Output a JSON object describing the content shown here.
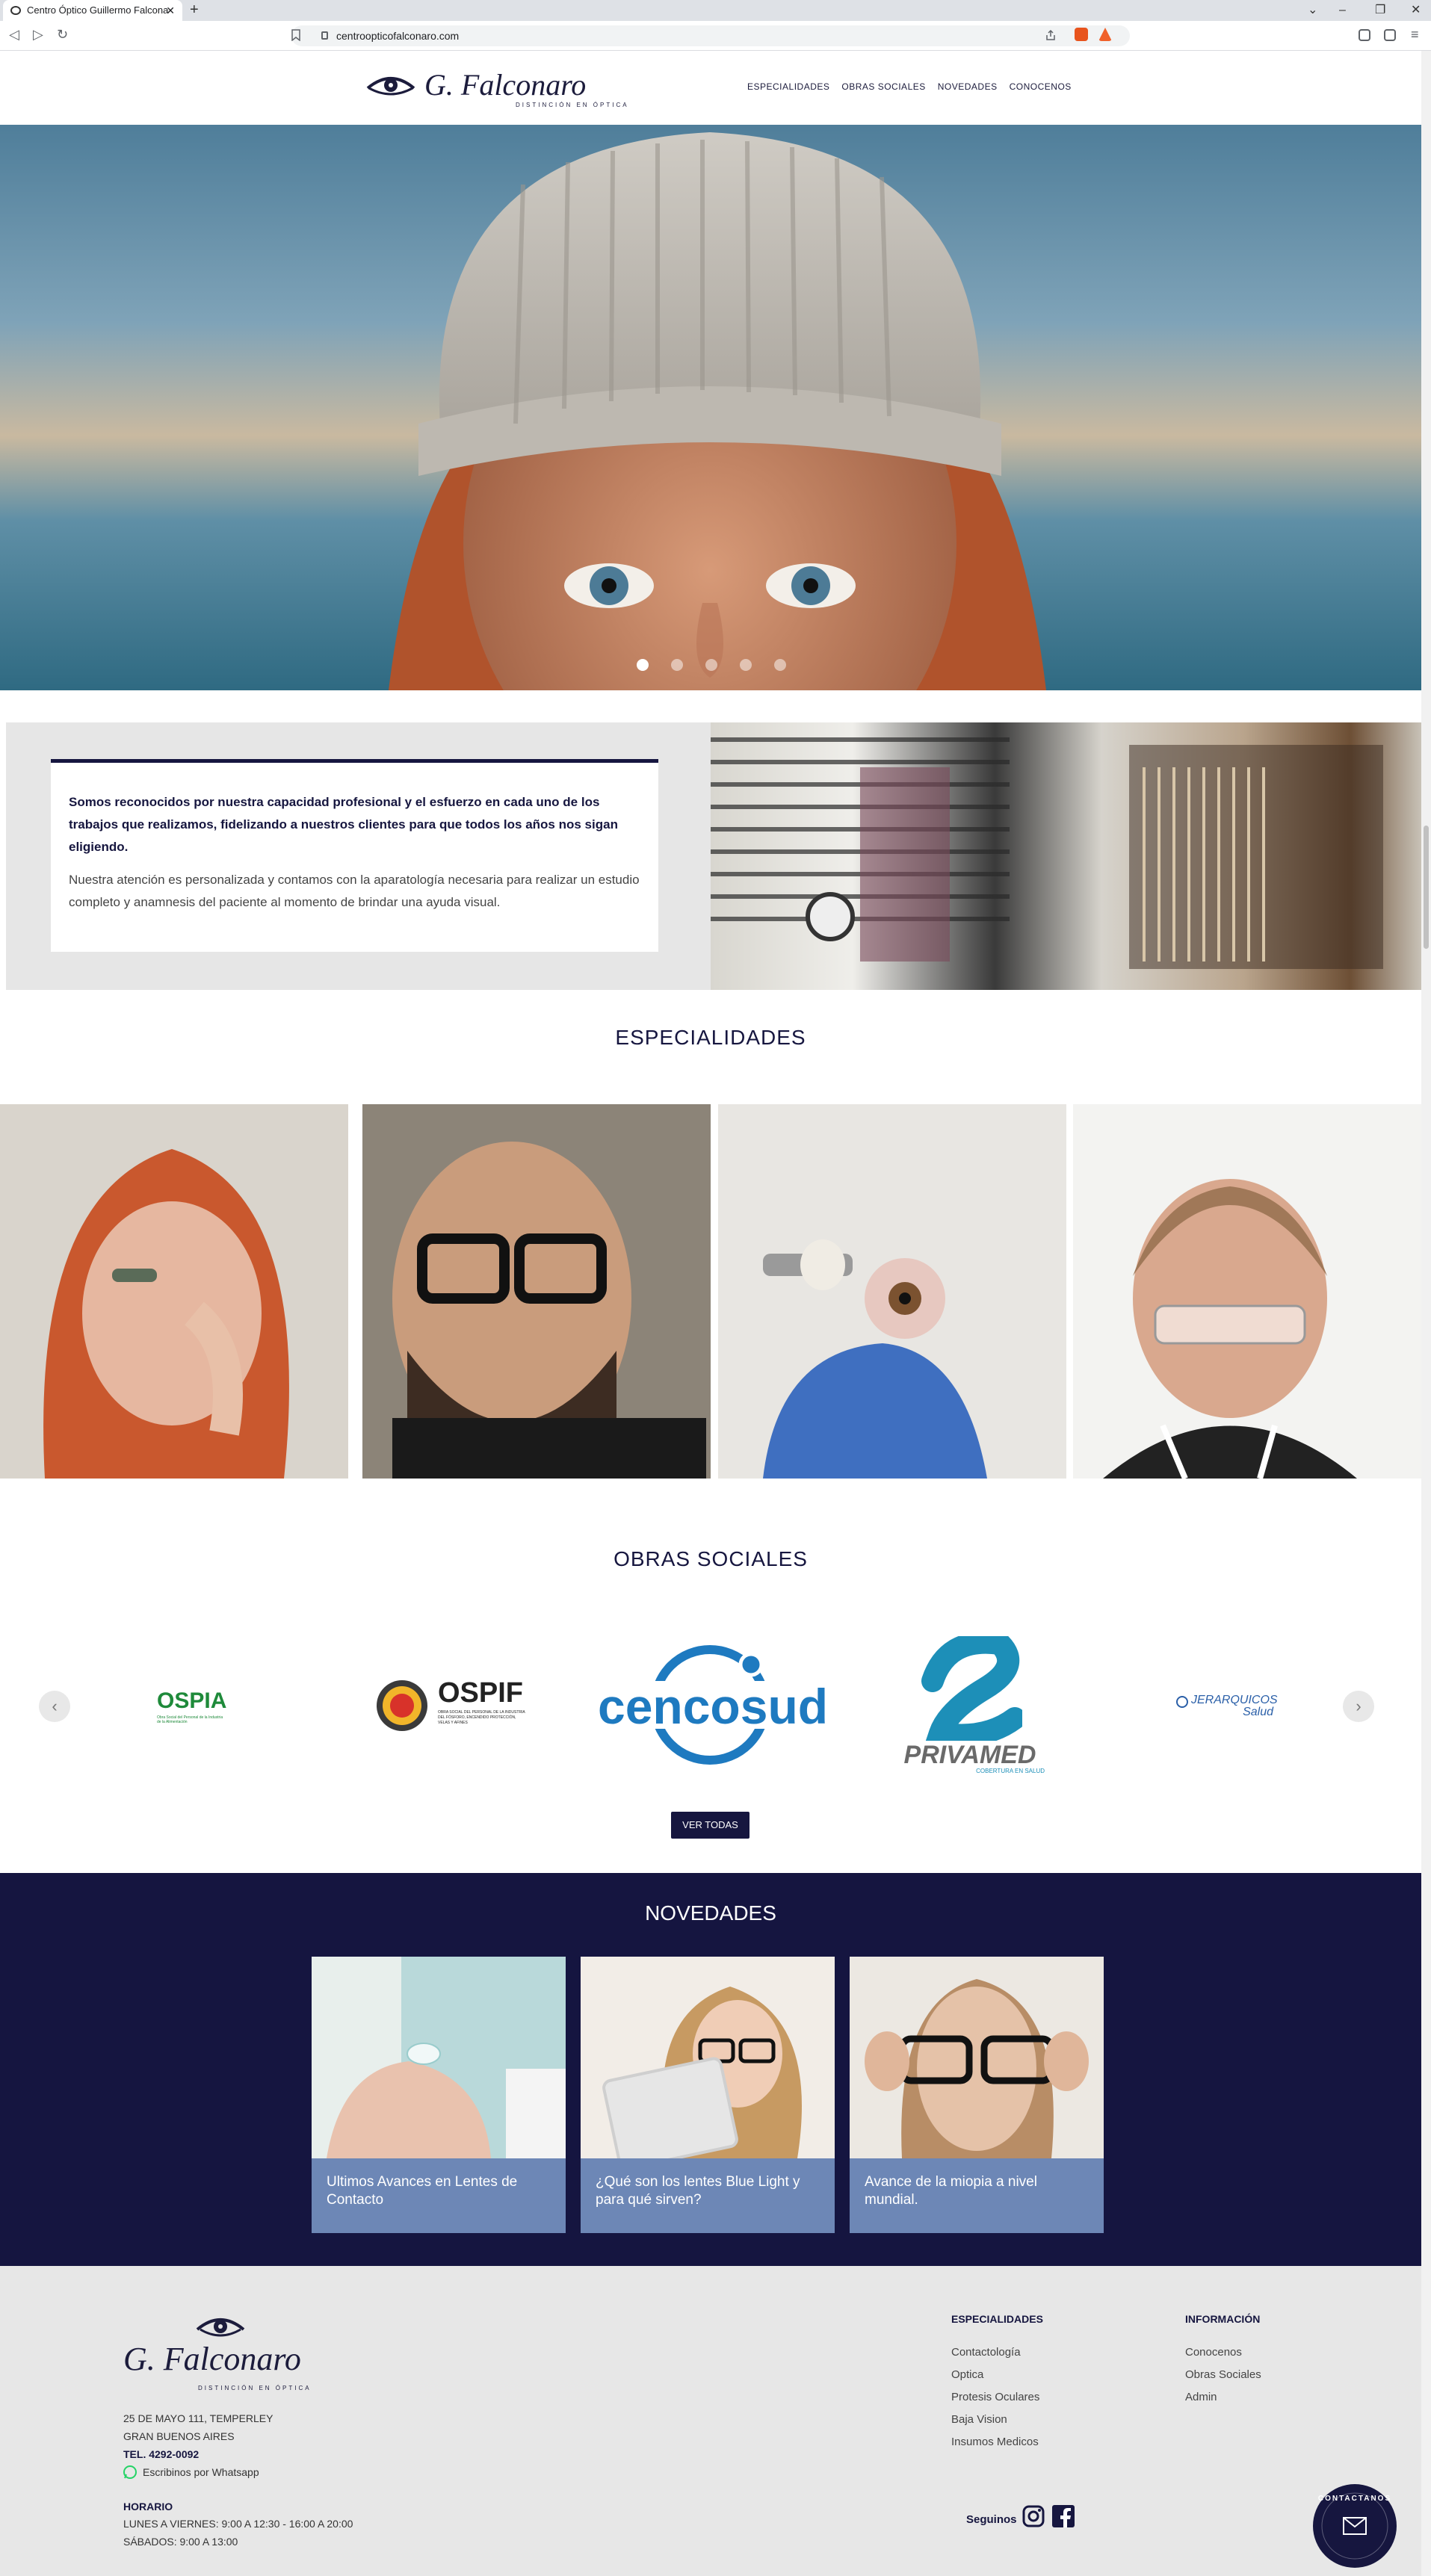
{
  "browser": {
    "tab_title": "Centro Óptico Guillermo Falcona",
    "tab_close": "✕",
    "new_tab": "+",
    "url": "centroopticofalconaro.com",
    "controls": {
      "minimize": "–",
      "maximize": "❐",
      "close": "✕",
      "dropdown": "⌄"
    }
  },
  "header": {
    "logo_text": "G. Falconaro",
    "logo_tagline": "DISTINCIÓN EN ÓPTICA",
    "nav": [
      "ESPECIALIDADES",
      "OBRAS SOCIALES",
      "NOVEDADES",
      "CONOCENOS"
    ]
  },
  "hero": {
    "slide_count": 5,
    "active_slide": 1
  },
  "intro": {
    "lead": "Somos reconocidos por nuestra capacidad profesional y el esfuerzo en cada uno de los trabajos que realizamos, fidelizando a nuestros clientes para que todos los años nos sigan eligiendo.",
    "body": "Nuestra atención es personalizada y contamos con la aparatología necesaria para realizar un estudio completo y anamnesis del paciente al momento de brindar una ayuda visual."
  },
  "especialidades": {
    "title": "ESPECIALIDADES"
  },
  "obras": {
    "title": "OBRAS SOCIALES",
    "logos": [
      "OSPIA",
      "OSPIF",
      "cencosud",
      "PRIVAMED",
      "JERARQUICOS Salud"
    ],
    "ospif_sub": "OBRA SOCIAL DEL PERSONAL DE LA INDUSTRIA DEL FÓSFORO, ENCENDIDO PROTECCIÓN, VELAS Y AFINES",
    "ospia_sub": "Obra Social del Personal de la Industria de la Alimentación",
    "privamed_sub": "COBERTURA EN SALUD",
    "prev": "‹",
    "next": "›",
    "button": "VER TODAS"
  },
  "novedades": {
    "title": "NOVEDADES",
    "cards": [
      {
        "caption": "Ultimos Avances en Lentes de Contacto"
      },
      {
        "caption": "¿Qué son los lentes Blue Light y para qué sirven?"
      },
      {
        "caption": "Avance de la miopia a nivel mundial."
      }
    ]
  },
  "footer": {
    "logo_text": "G. Falconaro",
    "logo_tagline": "DISTINCIÓN EN ÓPTICA",
    "address1": "25 DE MAYO 111, TEMPERLEY",
    "address2": "GRAN BUENOS AIRES",
    "phone": "TEL. 4292-0092",
    "whatsapp": "Escribinos por Whatsapp",
    "horario_title": "HORARIO",
    "horario1": "LUNES A VIERNES: 9:00 A 12:30 - 16:00 A 20:00",
    "horario2": "SÁBADOS: 9:00 A 13:00",
    "especialidades_title": "ESPECIALIDADES",
    "especialidades": [
      "Contactología",
      "Optica",
      "Protesis Oculares",
      "Baja Vision",
      "Insumos Medicos"
    ],
    "info_title": "INFORMACIÓN",
    "info": [
      "Conocenos",
      "Obras Sociales",
      "Admin"
    ],
    "seguinos": "Seguinos",
    "contact_badge": "CONTACTANOS"
  },
  "colors": {
    "navy": "#16163f",
    "card_blue": "#6d87b6",
    "footer_bg": "#e7e7e7"
  }
}
